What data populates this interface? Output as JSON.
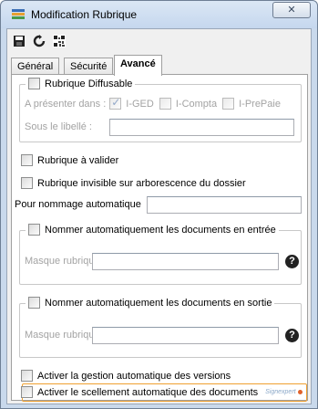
{
  "window": {
    "title": "Modification Rubrique",
    "close_glyph": "✕"
  },
  "toolbar": {
    "icons": [
      "save-icon",
      "refresh-icon",
      "qrcode-icon"
    ]
  },
  "tabs": [
    "Général",
    "Sécurité",
    "Avancé"
  ],
  "active_tab": "Avancé",
  "diffusable": {
    "label": "Rubrique Diffusable",
    "present_label": "A présenter dans :",
    "options": [
      "I-GED",
      "I-Compta",
      "I-PrePaie"
    ],
    "options_checked": [
      true,
      false,
      false
    ],
    "libelle_label": "Sous le libellé :",
    "libelle_value": ""
  },
  "valider_label": "Rubrique à valider",
  "invisible_label": "Rubrique invisible sur arborescence du dossier",
  "pour_nommage_label": "Pour nommage automatique",
  "pour_nommage_value": "",
  "entree": {
    "label": "Nommer automatiquement les documents en entrée",
    "masque_label": "Masque rubrique",
    "masque_value": ""
  },
  "sortie": {
    "label": "Nommer automatiquement les documents en sortie",
    "masque_label": "Masque rubrique",
    "masque_value": ""
  },
  "versions_label": "Activer la gestion automatique des versions",
  "scellement_label": "Activer le scellement automatique des documents",
  "scellement_logo": "Signexpert",
  "help_glyph": "?",
  "colors": {
    "accent_highlight": "#f0a030",
    "title_bar": "#c9d9ec"
  }
}
